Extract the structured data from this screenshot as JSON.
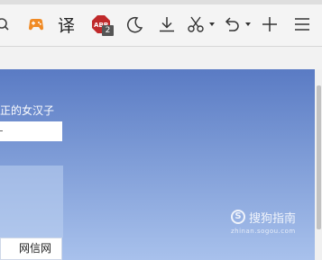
{
  "toolbar": {
    "icons": [
      "search-icon",
      "game-controller-icon",
      "translate-icon",
      "adblock-icon",
      "night-mode-icon",
      "download-icon",
      "screenshot-icon",
      "undo-icon",
      "new-tab-icon",
      "menu-icon"
    ],
    "translate_glyph": "译",
    "abp_label": "ABP",
    "abp_badge": "2",
    "accent_game": "#f08a24",
    "accent_abp": "#c0292b"
  },
  "page": {
    "tagline": "正的女汉子",
    "input_value": "",
    "wangxin_button": "网信网"
  },
  "watermark": {
    "logo_letter": "S",
    "text": "搜狗指南",
    "url": "zhinan.sogou.com"
  }
}
